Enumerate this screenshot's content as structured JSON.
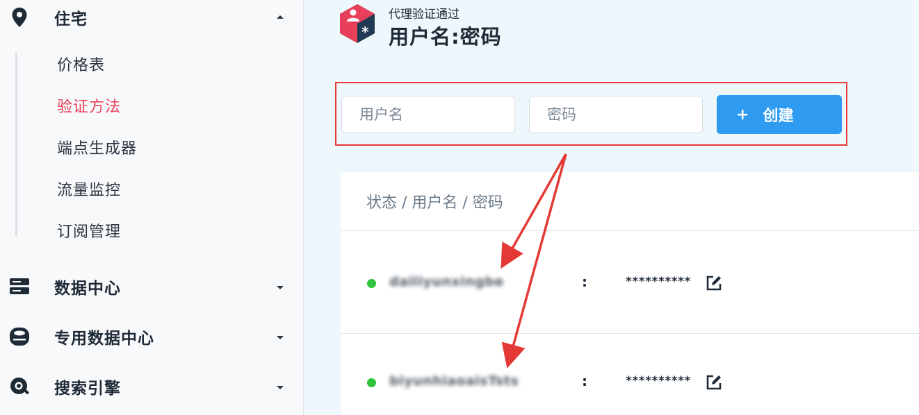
{
  "sidebar": {
    "sections": [
      {
        "label": "住宅",
        "icon": "map-pin-icon",
        "expanded": true
      },
      {
        "label": "数据中心",
        "icon": "server-icon",
        "expanded": false
      },
      {
        "label": "专用数据中心",
        "icon": "dedicated-server-icon",
        "expanded": false
      },
      {
        "label": "搜索引擎",
        "icon": "search-engine-icon",
        "expanded": false
      }
    ],
    "sub_items": [
      {
        "label": "价格表"
      },
      {
        "label": "验证方法",
        "active": true
      },
      {
        "label": "端点生成器"
      },
      {
        "label": "流量监控"
      },
      {
        "label": "订阅管理"
      }
    ]
  },
  "header": {
    "subtitle": "代理验证通过",
    "title": "用户名:密码",
    "logo_icon": "user-key-hexagon-icon"
  },
  "form": {
    "username_placeholder": "用户名",
    "password_placeholder": "密码",
    "create_plus": "+",
    "create_label": "创建"
  },
  "table": {
    "header": "状态 / 用户名 / 密码",
    "rows": [
      {
        "status": "active",
        "username": "dailiyunxingbe",
        "separator": ":",
        "password": "**********",
        "edit_icon": "edit-icon"
      },
      {
        "status": "active",
        "username": "biyunhiaoaisTsts",
        "separator": ":",
        "password": "**********",
        "edit_icon": "edit-icon"
      }
    ]
  },
  "colors": {
    "accent": "#e8405a",
    "primary_button": "#2f9bf0",
    "status_active": "#2fc43b",
    "annotation": "#e53935",
    "main_bg": "#eef7fc"
  }
}
